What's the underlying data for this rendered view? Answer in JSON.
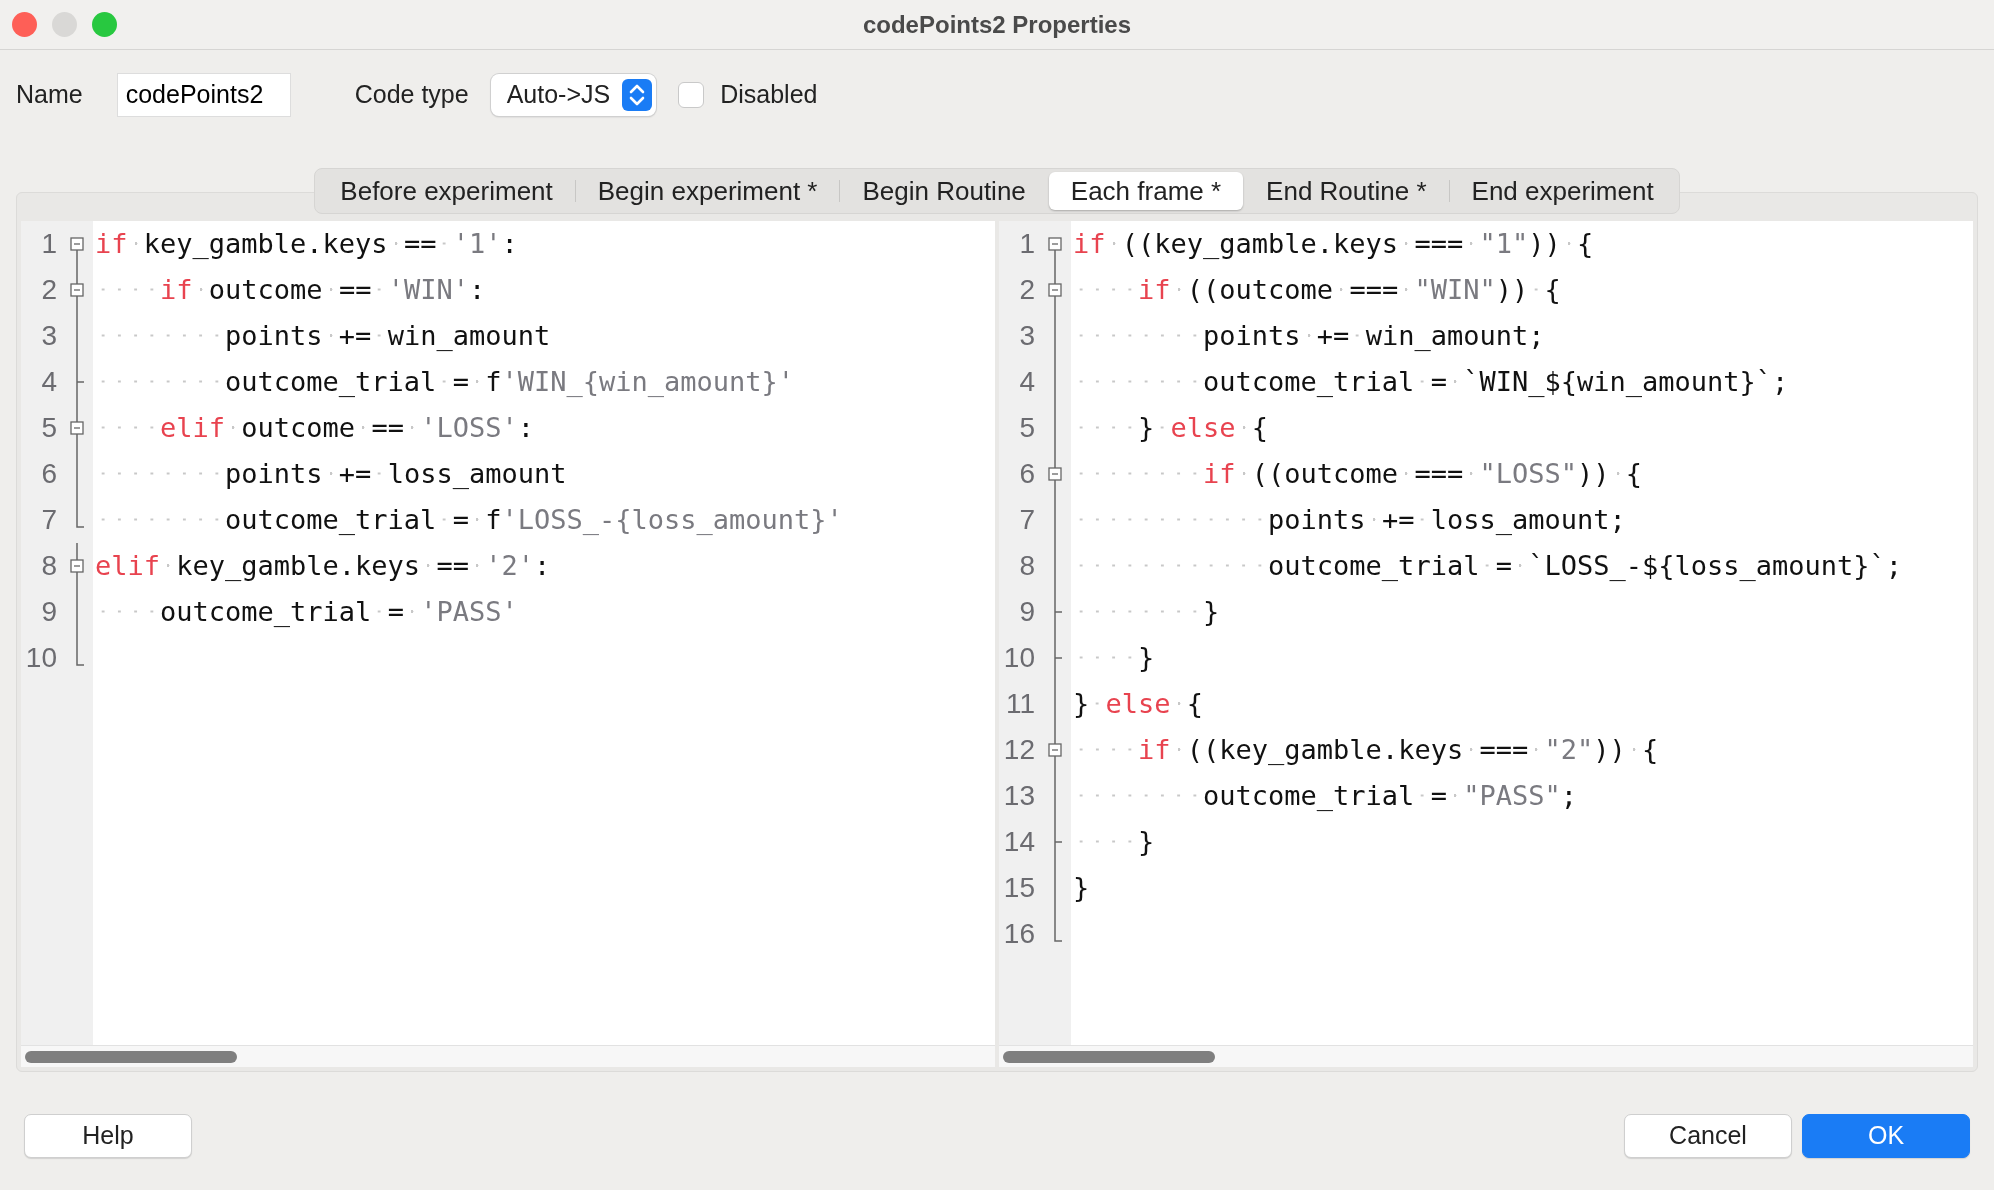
{
  "window": {
    "title": "codePoints2 Properties"
  },
  "form": {
    "name_label": "Name",
    "name_value": "codePoints2",
    "code_type_label": "Code type",
    "code_type_value": "Auto->JS",
    "disabled": {
      "label": "Disabled",
      "checked": false
    }
  },
  "tabs": [
    {
      "label": "Before experiment",
      "selected": false
    },
    {
      "label": "Begin experiment *",
      "selected": false
    },
    {
      "label": "Begin Routine",
      "selected": false
    },
    {
      "label": "Each frame *",
      "selected": true
    },
    {
      "label": "End Routine *",
      "selected": false
    },
    {
      "label": "End experiment",
      "selected": false
    }
  ],
  "editors": [
    {
      "lines": [
        {
          "number": "1",
          "kind": "fold-start",
          "tokens": [
            {
              "kind": "keyword",
              "text": "if"
            },
            {
              "kind": "plain",
              "text": " key_gamble.keys == "
            },
            {
              "kind": "string",
              "text": "'1'"
            },
            {
              "kind": "plain",
              "text": ":"
            }
          ]
        },
        {
          "number": "2",
          "kind": "fold-start",
          "tokens": [
            {
              "kind": "keyword",
              "text": "    if"
            },
            {
              "kind": "plain",
              "text": " outcome == "
            },
            {
              "kind": "string",
              "text": "'WIN'"
            },
            {
              "kind": "plain",
              "text": ":"
            }
          ]
        },
        {
          "number": "3",
          "kind": "fold-line",
          "tokens": [
            {
              "kind": "plain",
              "text": "        points += win_amount"
            }
          ]
        },
        {
          "number": "4",
          "kind": "fold-tick",
          "tokens": [
            {
              "kind": "plain",
              "text": "        outcome_trial = f"
            },
            {
              "kind": "string",
              "text": "'WIN_{win_amount}'"
            }
          ]
        },
        {
          "number": "5",
          "kind": "fold-start",
          "tokens": [
            {
              "kind": "keyword",
              "text": "    elif"
            },
            {
              "kind": "plain",
              "text": " outcome == "
            },
            {
              "kind": "string",
              "text": "'LOSS'"
            },
            {
              "kind": "plain",
              "text": ":"
            }
          ]
        },
        {
          "number": "6",
          "kind": "fold-line",
          "tokens": [
            {
              "kind": "plain",
              "text": "        points += loss_amount"
            }
          ]
        },
        {
          "number": "7",
          "kind": "fold-end",
          "tokens": [
            {
              "kind": "plain",
              "text": "        outcome_trial = f"
            },
            {
              "kind": "string",
              "text": "'LOSS_-{loss_amount}'"
            }
          ]
        },
        {
          "number": "8",
          "kind": "fold-start",
          "tokens": [
            {
              "kind": "keyword",
              "text": "elif"
            },
            {
              "kind": "plain",
              "text": " key_gamble.keys == "
            },
            {
              "kind": "string",
              "text": "'2'"
            },
            {
              "kind": "plain",
              "text": ":"
            }
          ]
        },
        {
          "number": "9",
          "kind": "fold-line",
          "tokens": [
            {
              "kind": "plain",
              "text": "    outcome_trial = "
            },
            {
              "kind": "string",
              "text": "'PASS'"
            }
          ]
        },
        {
          "number": "10",
          "kind": "fold-end"
        }
      ]
    },
    {
      "lines": [
        {
          "number": "1",
          "kind": "fold-start",
          "tokens": [
            {
              "kind": "keyword",
              "text": "if"
            },
            {
              "kind": "plain",
              "text": " ((key_gamble.keys === "
            },
            {
              "kind": "string",
              "text": "\"1\""
            },
            {
              "kind": "plain",
              "text": ")) {"
            }
          ]
        },
        {
          "number": "2",
          "kind": "fold-start",
          "tokens": [
            {
              "kind": "keyword",
              "text": "    if"
            },
            {
              "kind": "plain",
              "text": " ((outcome === "
            },
            {
              "kind": "string",
              "text": "\"WIN\""
            },
            {
              "kind": "plain",
              "text": ")) {"
            }
          ]
        },
        {
          "number": "3",
          "kind": "fold-line",
          "tokens": [
            {
              "kind": "plain",
              "text": "        points += win_amount;"
            }
          ]
        },
        {
          "number": "4",
          "kind": "fold-line",
          "tokens": [
            {
              "kind": "plain",
              "text": "        outcome_trial = `WIN_${win_amount}`;"
            }
          ]
        },
        {
          "number": "5",
          "kind": "fold-line",
          "tokens": [
            {
              "kind": "plain",
              "text": "    } "
            },
            {
              "kind": "keyword",
              "text": "else"
            },
            {
              "kind": "plain",
              "text": " {"
            }
          ]
        },
        {
          "number": "6",
          "kind": "fold-start",
          "tokens": [
            {
              "kind": "keyword",
              "text": "        if"
            },
            {
              "kind": "plain",
              "text": " ((outcome === "
            },
            {
              "kind": "string",
              "text": "\"LOSS\""
            },
            {
              "kind": "plain",
              "text": ")) {"
            }
          ]
        },
        {
          "number": "7",
          "kind": "fold-line",
          "tokens": [
            {
              "kind": "plain",
              "text": "            points += loss_amount;"
            }
          ]
        },
        {
          "number": "8",
          "kind": "fold-line",
          "tokens": [
            {
              "kind": "plain",
              "text": "            outcome_trial = `LOSS_-${loss_amount}`;"
            }
          ]
        },
        {
          "number": "9",
          "kind": "fold-tick",
          "tokens": [
            {
              "kind": "plain",
              "text": "        }"
            }
          ]
        },
        {
          "number": "10",
          "kind": "fold-tick",
          "tokens": [
            {
              "kind": "plain",
              "text": "    }"
            }
          ]
        },
        {
          "number": "11",
          "kind": "fold-line",
          "tokens": [
            {
              "kind": "plain",
              "text": "} "
            },
            {
              "kind": "keyword",
              "text": "else"
            },
            {
              "kind": "plain",
              "text": " {"
            }
          ]
        },
        {
          "number": "12",
          "kind": "fold-start",
          "tokens": [
            {
              "kind": "keyword",
              "text": "    if"
            },
            {
              "kind": "plain",
              "text": " ((key_gamble.keys === "
            },
            {
              "kind": "string",
              "text": "\"2\""
            },
            {
              "kind": "plain",
              "text": ")) {"
            }
          ]
        },
        {
          "number": "13",
          "kind": "fold-line",
          "tokens": [
            {
              "kind": "plain",
              "text": "        outcome_trial = "
            },
            {
              "kind": "string",
              "text": "\"PASS\""
            },
            {
              "kind": "plain",
              "text": ";"
            }
          ]
        },
        {
          "number": "14",
          "kind": "fold-tick",
          "tokens": [
            {
              "kind": "plain",
              "text": "    }"
            }
          ]
        },
        {
          "number": "15",
          "kind": "fold-line",
          "tokens": [
            {
              "kind": "plain",
              "text": "}"
            }
          ]
        },
        {
          "number": "16",
          "kind": "fold-end"
        }
      ]
    }
  ],
  "buttons": [
    {
      "label": "Help",
      "kind": "plain"
    },
    {
      "label": "Cancel",
      "kind": "plain"
    },
    {
      "label": "OK",
      "kind": "primary"
    }
  ]
}
